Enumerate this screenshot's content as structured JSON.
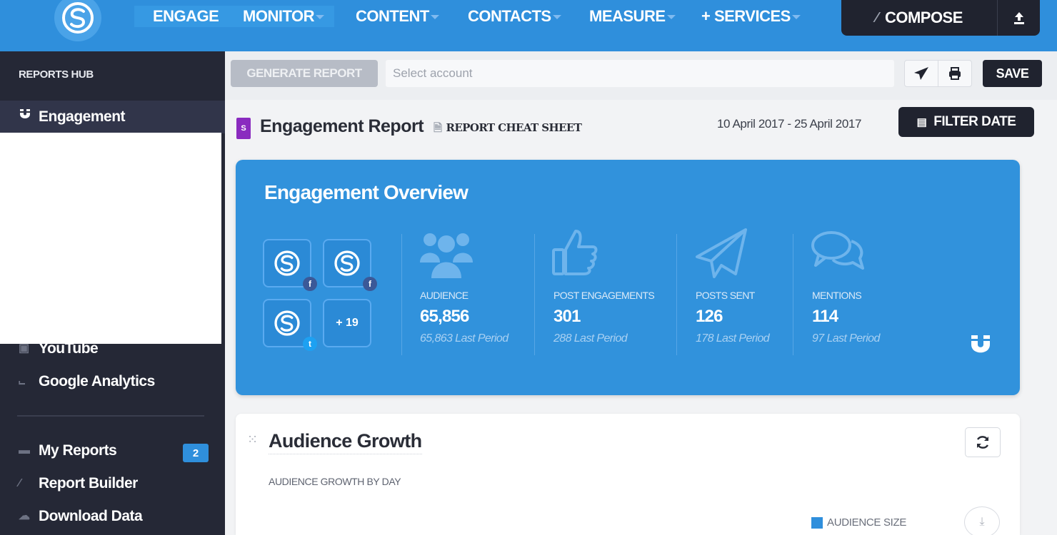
{
  "nav": {
    "items": [
      {
        "label": "ENGAGE",
        "dropdown": false
      },
      {
        "label": "MONITOR",
        "dropdown": true
      },
      {
        "label": "CONTENT",
        "dropdown": true
      },
      {
        "label": "CONTACTS",
        "dropdown": true
      },
      {
        "label": "MEASURE",
        "dropdown": true
      },
      {
        "label": "+ SERVICES",
        "dropdown": true
      }
    ],
    "compose_label": "COMPOSE",
    "colors": {
      "bar": "#2f8fdc",
      "dark": "#20232f"
    }
  },
  "sidebar": {
    "title": "REPORTS HUB",
    "items": [
      {
        "label": "Engagement",
        "icon": "magnet-icon",
        "active": true
      },
      {
        "label": "YouTube",
        "icon": "youtube-icon"
      },
      {
        "label": "Google Analytics",
        "icon": "chart-icon"
      },
      {
        "label": "My Reports",
        "icon": "folder-icon",
        "badge": "2"
      },
      {
        "label": "Report Builder",
        "icon": "wrench-icon"
      },
      {
        "label": "Download Data",
        "icon": "cloud-icon"
      }
    ]
  },
  "toolbar": {
    "generate_label": "GENERATE REPORT",
    "account_placeholder": "Select account",
    "save_label": "SAVE"
  },
  "report": {
    "badge": "S",
    "title": "Engagement Report",
    "cheat_sheet": "REPORT CHEAT SHEET",
    "date_range": "10 April 2017 - 25 April 2017",
    "filter_label": "FILTER DATE"
  },
  "overview": {
    "title": "Engagement Overview",
    "more_accounts": "+ 19",
    "stats": [
      {
        "label": "AUDIENCE",
        "value": "65,856",
        "last": "65,863 Last Period",
        "icon": "users-icon"
      },
      {
        "label": "POST ENGAGEMENTS",
        "value": "301",
        "last": "288 Last Period",
        "icon": "thumbs-up-icon"
      },
      {
        "label": "POSTS SENT",
        "value": "126",
        "last": "178 Last Period",
        "icon": "paper-plane-icon"
      },
      {
        "label": "MENTIONS",
        "value": "114",
        "last": "97 Last Period",
        "icon": "chat-bubbles-icon"
      }
    ],
    "color": "#3192dc"
  },
  "growth": {
    "title": "Audience Growth",
    "subtitle": "AUDIENCE GROWTH BY DAY",
    "legend": "AUDIENCE SIZE"
  }
}
